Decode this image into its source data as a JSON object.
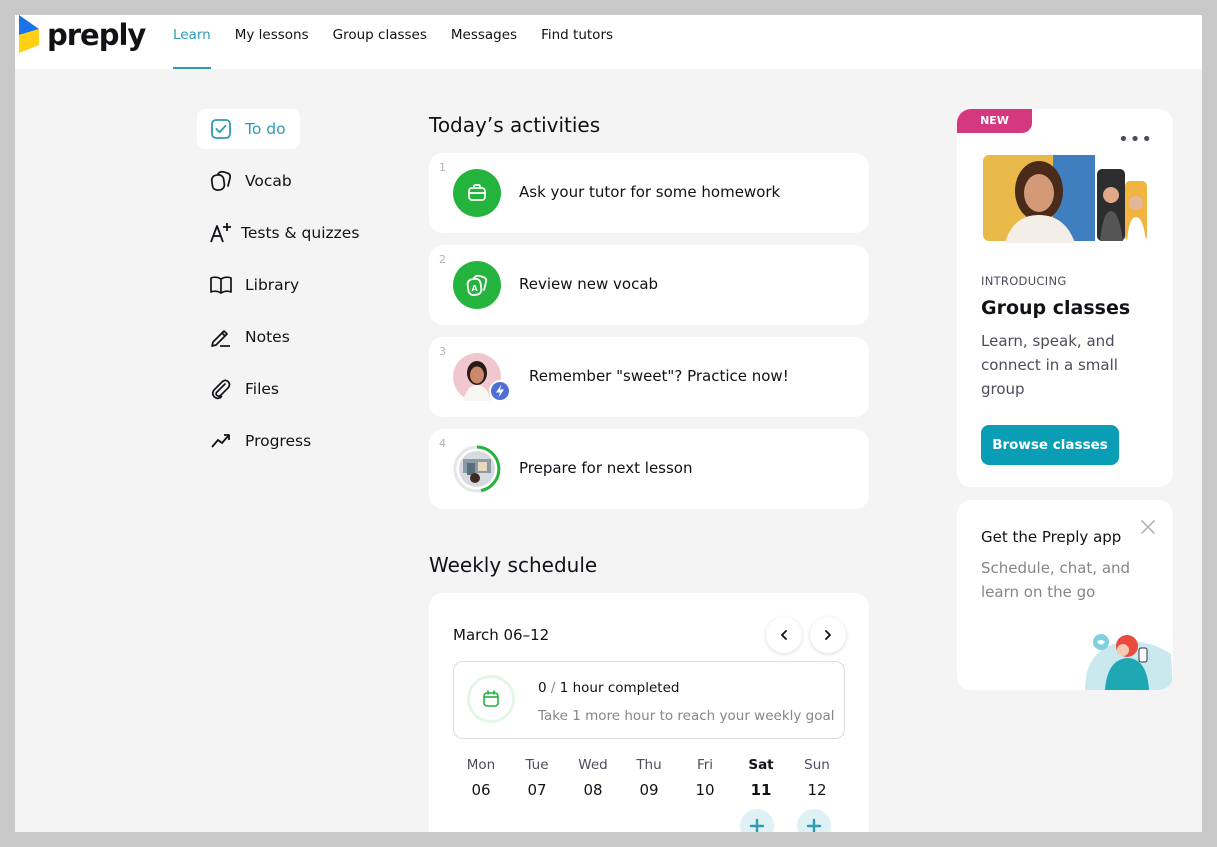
{
  "brand": {
    "name": "preply"
  },
  "nav": {
    "items": [
      "Learn",
      "My lessons",
      "Group classes",
      "Messages",
      "Find tutors"
    ],
    "active": "Learn"
  },
  "sidebar": {
    "items": [
      {
        "label": "To do",
        "icon": "checkbox-icon",
        "active": true
      },
      {
        "label": "Vocab",
        "icon": "vocab-cards-icon"
      },
      {
        "label": "Tests & quizzes",
        "icon": "grade-a-plus-icon"
      },
      {
        "label": "Library",
        "icon": "book-icon"
      },
      {
        "label": "Notes",
        "icon": "pencil-icon"
      },
      {
        "label": "Files",
        "icon": "paperclip-icon"
      },
      {
        "label": "Progress",
        "icon": "trend-up-icon"
      }
    ]
  },
  "activities": {
    "title": "Today’s activities",
    "items": [
      {
        "num": "1",
        "text": "Ask your tutor for some homework",
        "icon": "briefcase-icon"
      },
      {
        "num": "2",
        "text": "Review new vocab",
        "icon": "vocab-cards-icon"
      },
      {
        "num": "3",
        "text": "Remember \"sweet\"? Practice now!",
        "icon": "tutor-avatar"
      },
      {
        "num": "4",
        "text": "Prepare for next lesson",
        "icon": "lesson-progress-avatar"
      }
    ]
  },
  "schedule": {
    "title": "Weekly schedule",
    "range": "March 06–12",
    "goal_done": "0",
    "goal_sep": " / ",
    "goal_total": "1 hour completed",
    "goal_sub": "Take 1 more hour to reach your weekly goal",
    "days": [
      {
        "name": "Mon",
        "num": "06"
      },
      {
        "name": "Tue",
        "num": "07"
      },
      {
        "name": "Wed",
        "num": "08"
      },
      {
        "name": "Thu",
        "num": "09"
      },
      {
        "name": "Fri",
        "num": "10"
      },
      {
        "name": "Sat",
        "num": "11",
        "today": true
      },
      {
        "name": "Sun",
        "num": "12"
      }
    ]
  },
  "promo": {
    "badge": "NEW",
    "kicker": "INTRODUCING",
    "title": "Group classes",
    "desc": "Learn, speak, and connect in a small group",
    "button": "Browse classes"
  },
  "app_card": {
    "title": "Get the Preply app",
    "desc": "Schedule, chat, and learn on the go"
  },
  "colors": {
    "accent": "#2e9bb3",
    "green": "#24b33c",
    "button": "#0a9eb6",
    "badge": "#d6387f"
  }
}
